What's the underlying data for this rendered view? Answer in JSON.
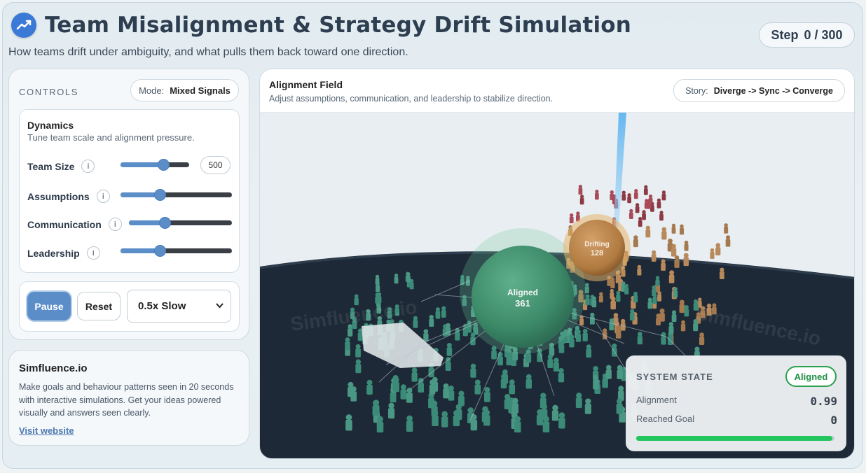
{
  "header": {
    "title": "Team Misalignment & Strategy Drift Simulation",
    "subtitle": "How teams drift under ambiguity, and what pulls them back toward one direction.",
    "step_label": "Step",
    "step_value": "0 / 300"
  },
  "controls": {
    "section_label": "CONTROLS",
    "mode_key": "Mode:",
    "mode_value": "Mixed Signals",
    "dynamics": {
      "title": "Dynamics",
      "desc": "Tune team scale and alignment pressure.",
      "team_size": {
        "label": "Team Size",
        "value": "500",
        "level": 0.62
      },
      "assumptions": {
        "label": "Assumptions",
        "level": 0.35
      },
      "communication": {
        "label": "Communication",
        "level": 0.35
      },
      "leadership": {
        "label": "Leadership",
        "level": 0.35
      },
      "info_glyph": "i"
    },
    "pause_label": "Pause",
    "reset_label": "Reset",
    "speed_value": "0.5x Slow"
  },
  "promo": {
    "title": "Simfluence.io",
    "body": "Make goals and behaviour patterns seen in 20 seconds with interactive simulations. Get your ideas powered visually and answers seen clearly.",
    "link": "Visit website"
  },
  "field": {
    "title": "Alignment Field",
    "subtitle": "Adjust assumptions, communication, and leadership to stabilize direction.",
    "story_key": "Story:",
    "story_value": "Diverge -> Sync -> Converge",
    "aligned_label": "Aligned",
    "aligned_count": "361",
    "drifting_label": "Drifting",
    "drifting_count": "128",
    "watermark": "Simfluence.io"
  },
  "state": {
    "label": "SYSTEM STATE",
    "badge": "Aligned",
    "alignment_label": "Alignment",
    "alignment_value": "0.99",
    "goal_label": "Reached Goal",
    "goal_value": "0",
    "progress_level": 0.99
  },
  "colors": {
    "accent": "#5b8ec8",
    "aligned": "#3c8a78",
    "drifting": "#b8895a",
    "outlier": "#8c3b45",
    "ok": "#22c55e"
  },
  "icons": {
    "logo": "trend-line-icon",
    "info": "info-icon",
    "dropdown": "chevron-down-icon"
  }
}
